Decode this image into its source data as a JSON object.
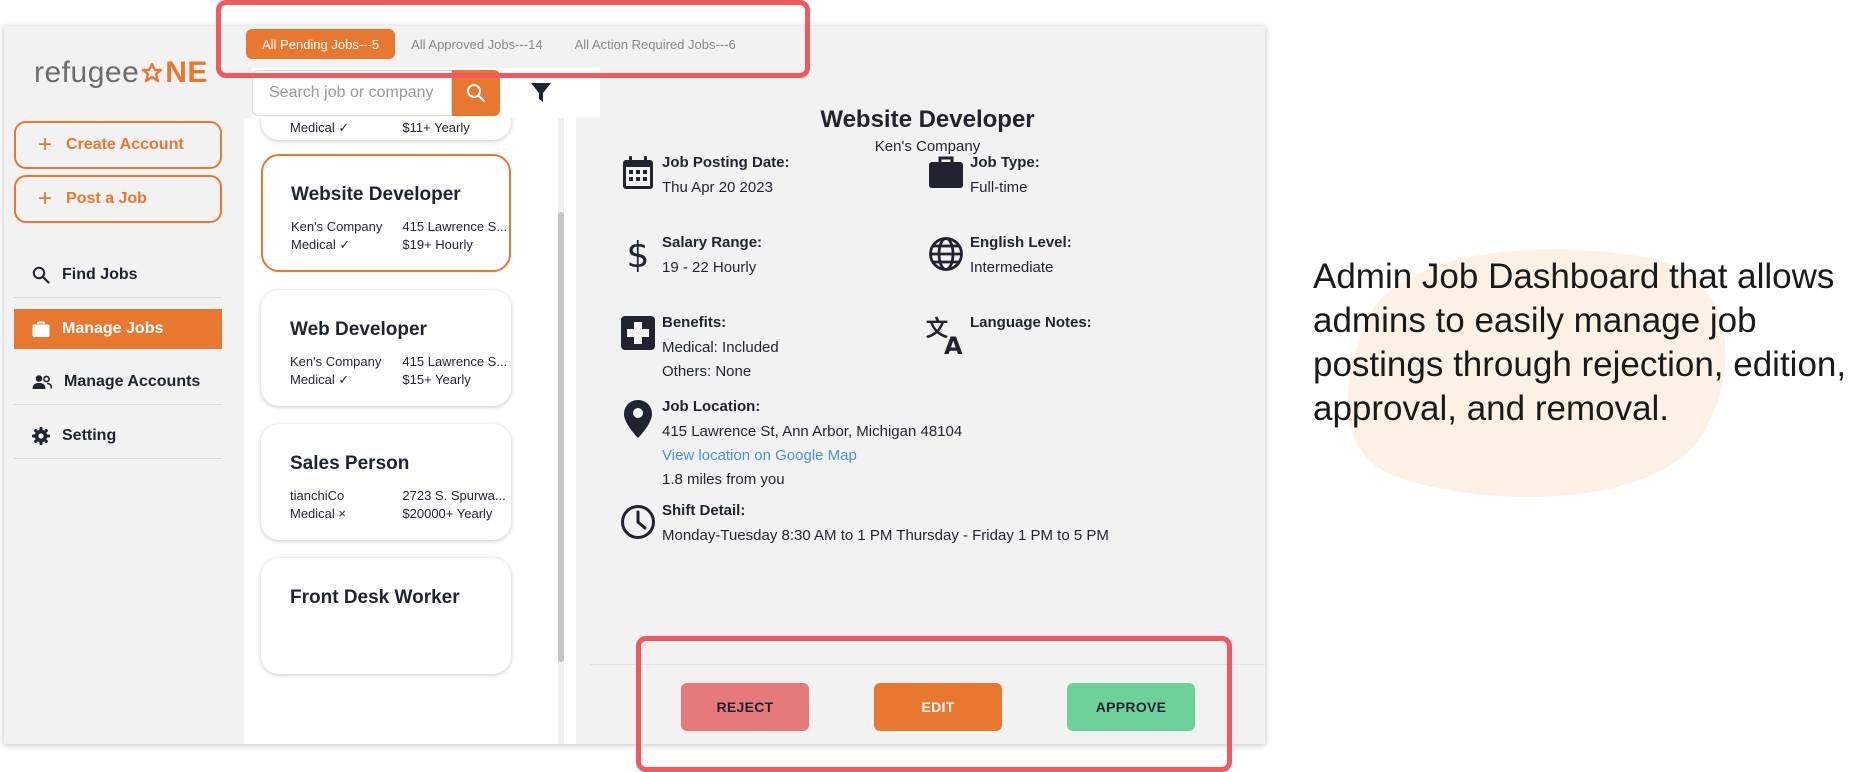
{
  "colors": {
    "accent": "#e8782f",
    "reject": "#e67a7a",
    "approve": "#6fd19a",
    "highlight": "#f05a5f",
    "link": "#4a90e2"
  },
  "logo": {
    "text_a": "refugee",
    "text_b": "NE"
  },
  "sidebar": {
    "create_account": "Create Account",
    "post_job": "Post a Job",
    "nav": [
      {
        "label": "Find Jobs",
        "icon": "search-icon"
      },
      {
        "label": "Manage Jobs",
        "icon": "briefcase-icon"
      },
      {
        "label": "Manage Accounts",
        "icon": "people-icon"
      },
      {
        "label": "Setting",
        "icon": "gear-icon"
      }
    ]
  },
  "tabs": [
    "All Pending Jobs---5",
    "All Approved Jobs---14",
    "All Action Required Jobs---6"
  ],
  "search": {
    "placeholder": "Search job or company"
  },
  "cards": [
    {
      "title": "",
      "company": "Medical ✓",
      "location": "$11+ Yearly",
      "medical": "",
      "pay": ""
    },
    {
      "title": "Website Developer",
      "company": "Ken's Company",
      "location": "415 Lawrence S...",
      "medical": "Medical ✓",
      "pay": "$19+ Hourly"
    },
    {
      "title": "Web Developer",
      "company": "Ken's Company",
      "location": "415 Lawrence S...",
      "medical": "Medical ✓",
      "pay": "$15+ Yearly"
    },
    {
      "title": "Sales Person",
      "company": "tianchiCo",
      "location": "2723 S. Spurwa...",
      "medical": "Medical ×",
      "pay": "$20000+ Yearly"
    },
    {
      "title": "Front Desk Worker"
    }
  ],
  "detail": {
    "title": "Website Developer",
    "company": "Ken's Company",
    "posting_date_label": "Job Posting Date:",
    "posting_date": "Thu Apr 20 2023",
    "job_type_label": "Job Type:",
    "job_type": "Full-time",
    "salary_label": "Salary Range:",
    "salary": "19 - 22 Hourly",
    "english_label": "English Level:",
    "english": "Intermediate",
    "benefits_label": "Benefits:",
    "benefits_medical": "Medical: Included",
    "benefits_other": "Others: None",
    "language_notes_label": "Language Notes:",
    "location_label": "Job Location:",
    "location": "415 Lawrence St, Ann Arbor, Michigan 48104",
    "map_link": "View location on Google Map",
    "distance": "1.8 miles from you",
    "shift_label": "Shift Detail:",
    "shift": "Monday-Tuesday 8:30 AM to 1 PM Thursday - Friday 1 PM to 5 PM"
  },
  "actions": {
    "reject": "REJECT",
    "edit": "EDIT",
    "approve": "APPROVE"
  },
  "caption": "Admin Job Dashboard that allows admins to easily manage job postings through rejection, edition, approval, and removal."
}
